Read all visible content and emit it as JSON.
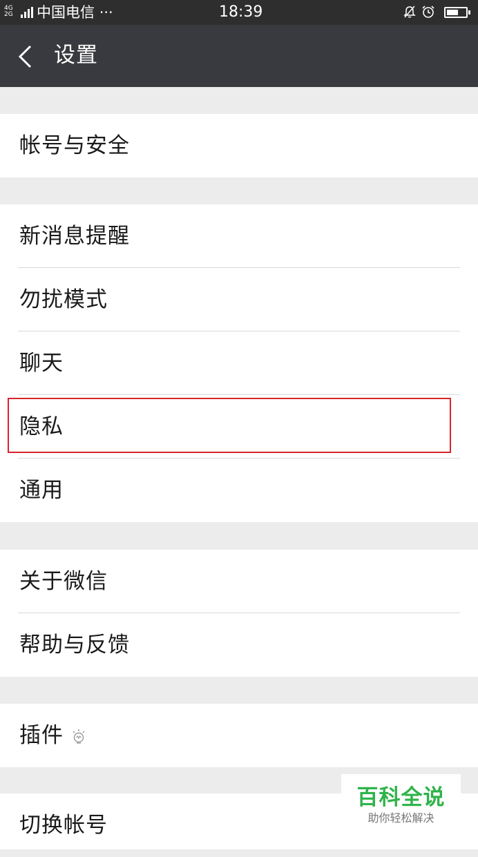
{
  "status_bar": {
    "network": [
      "4G",
      "2G"
    ],
    "carrier": "中国电信",
    "more": "···",
    "time": "18:39",
    "icons": [
      "mute-bell-icon",
      "alarm-icon",
      "battery-icon"
    ],
    "battery_level": 0.6
  },
  "header": {
    "back_icon": "chevron-left-icon",
    "title": "设置"
  },
  "groups": [
    {
      "items": [
        "帐号与安全"
      ]
    },
    {
      "items": [
        "新消息提醒",
        "勿扰模式",
        "聊天",
        "隐私",
        "通用"
      ]
    },
    {
      "items": [
        "关于微信",
        "帮助与反馈"
      ]
    },
    {
      "items": [
        "插件"
      ],
      "item_icon": "lightbulb-icon"
    },
    {
      "items": [
        "切换帐号"
      ]
    }
  ],
  "highlighted_item": "隐私",
  "colors": {
    "status_bar_bg": "#2e2e2e",
    "header_bg": "#393a3f",
    "page_bg": "#ececec",
    "highlight": "#d8232a",
    "watermark_green": "#2fb34a"
  },
  "watermark": {
    "title": "百科全说",
    "subtitle": "助你轻松解决"
  }
}
